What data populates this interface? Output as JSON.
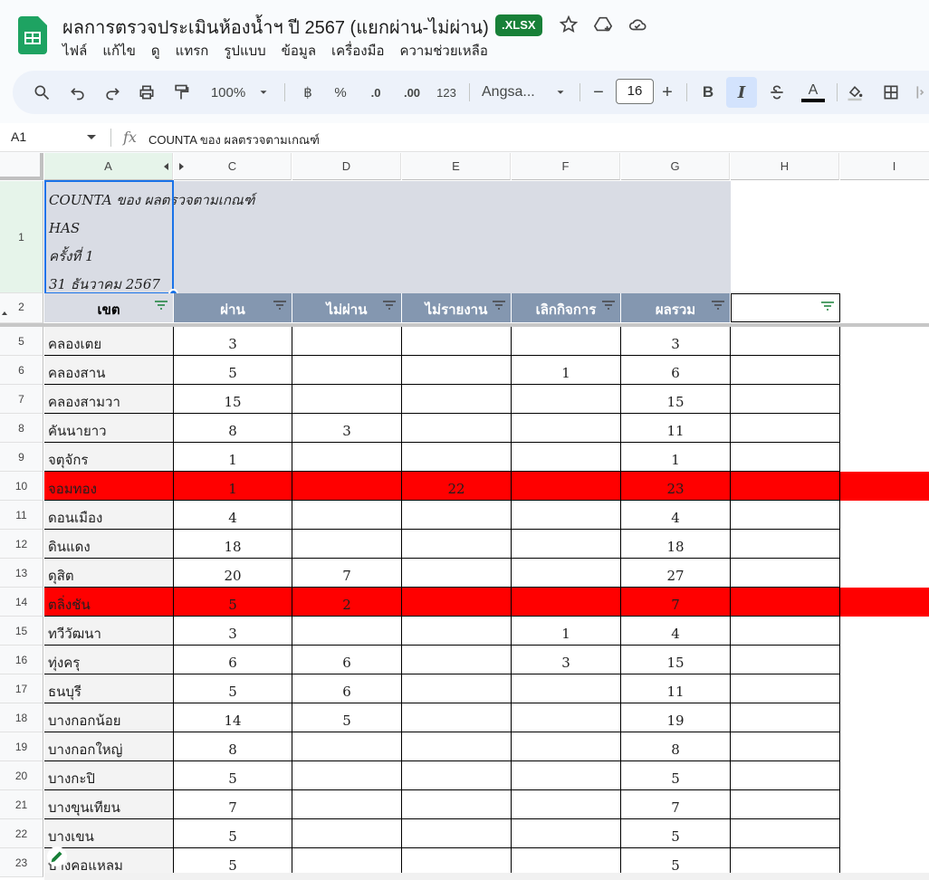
{
  "app": {
    "title": "ผลการตรวจประเมินห้องน้ำฯ ปี 2567 (แยกผ่าน-ไม่ผ่าน)",
    "badge": ".XLSX",
    "menu": [
      "ไฟล์",
      "แก้ไข",
      "ดู",
      "แทรก",
      "รูปแบบ",
      "ข้อมูล",
      "เครื่องมือ",
      "ความช่วยเหลือ"
    ]
  },
  "toolbar": {
    "zoom": "100%",
    "currency": "฿",
    "percent": "%",
    "dec_minus": ".0",
    "dec_plus": ".00",
    "format_123": "123",
    "font": "Angsa...",
    "font_size": "16",
    "bold": "B",
    "italic": "I",
    "minus": "−",
    "plus": "+",
    "text_color": "A"
  },
  "formula_bar": {
    "cell_ref": "A1",
    "fx": "fx",
    "formula": "COUNTA ของ ผลตรวจตามเกณฑ์"
  },
  "columns": [
    "A",
    "C",
    "D",
    "E",
    "F",
    "G",
    "H",
    "I"
  ],
  "pivot_title": {
    "line1": "COUNTA ของ ผลตรวจตามเกณฑ์",
    "line2": "HAS",
    "line3": "ครั้งที่ 1",
    "line4": "31 ธันวาคม 2567"
  },
  "headers": [
    "เขต",
    "ผ่าน",
    "ไม่ผ่าน",
    "ไม่รายงาน",
    "เลิกกิจการ",
    "ผลรวม"
  ],
  "rows": [
    {
      "num": "5",
      "name": "คลองเตย",
      "pass": "3",
      "fail": "",
      "noreport": "",
      "closed": "",
      "total": "3",
      "red": false
    },
    {
      "num": "6",
      "name": "คลองสาน",
      "pass": "5",
      "fail": "",
      "noreport": "",
      "closed": "1",
      "total": "6",
      "red": false
    },
    {
      "num": "7",
      "name": "คลองสามวา",
      "pass": "15",
      "fail": "",
      "noreport": "",
      "closed": "",
      "total": "15",
      "red": false
    },
    {
      "num": "8",
      "name": "คันนายาว",
      "pass": "8",
      "fail": "3",
      "noreport": "",
      "closed": "",
      "total": "11",
      "red": false
    },
    {
      "num": "9",
      "name": "จตุจักร",
      "pass": "1",
      "fail": "",
      "noreport": "",
      "closed": "",
      "total": "1",
      "red": false
    },
    {
      "num": "10",
      "name": "จอมทอง",
      "pass": "1",
      "fail": "",
      "noreport": "22",
      "closed": "",
      "total": "23",
      "red": true
    },
    {
      "num": "11",
      "name": "ดอนเมือง",
      "pass": "4",
      "fail": "",
      "noreport": "",
      "closed": "",
      "total": "4",
      "red": false
    },
    {
      "num": "12",
      "name": "ดินแดง",
      "pass": "18",
      "fail": "",
      "noreport": "",
      "closed": "",
      "total": "18",
      "red": false
    },
    {
      "num": "13",
      "name": "ดุสิต",
      "pass": "20",
      "fail": "7",
      "noreport": "",
      "closed": "",
      "total": "27",
      "red": false
    },
    {
      "num": "14",
      "name": "ตลิ่งชัน",
      "pass": "5",
      "fail": "2",
      "noreport": "",
      "closed": "",
      "total": "7",
      "red": true
    },
    {
      "num": "15",
      "name": "ทวีวัฒนา",
      "pass": "3",
      "fail": "",
      "noreport": "",
      "closed": "1",
      "total": "4",
      "red": false
    },
    {
      "num": "16",
      "name": "ทุ่งครุ",
      "pass": "6",
      "fail": "6",
      "noreport": "",
      "closed": "3",
      "total": "15",
      "red": false
    },
    {
      "num": "17",
      "name": "ธนบุรี",
      "pass": "5",
      "fail": "6",
      "noreport": "",
      "closed": "",
      "total": "11",
      "red": false
    },
    {
      "num": "18",
      "name": "บางกอกน้อย",
      "pass": "14",
      "fail": "5",
      "noreport": "",
      "closed": "",
      "total": "19",
      "red": false
    },
    {
      "num": "19",
      "name": "บางกอกใหญ่",
      "pass": "8",
      "fail": "",
      "noreport": "",
      "closed": "",
      "total": "8",
      "red": false
    },
    {
      "num": "20",
      "name": "บางกะปิ",
      "pass": "5",
      "fail": "",
      "noreport": "",
      "closed": "",
      "total": "5",
      "red": false
    },
    {
      "num": "21",
      "name": "บางขุนเทียน",
      "pass": "7",
      "fail": "",
      "noreport": "",
      "closed": "",
      "total": "7",
      "red": false
    },
    {
      "num": "22",
      "name": "บางเขน",
      "pass": "5",
      "fail": "",
      "noreport": "",
      "closed": "",
      "total": "5",
      "red": false
    },
    {
      "num": "23",
      "name": "บางคอแหลม",
      "pass": "5",
      "fail": "",
      "noreport": "",
      "closed": "",
      "total": "5",
      "red": false
    }
  ],
  "row_numbers_top": [
    "1",
    "2"
  ],
  "colors": {
    "header_bg": "#8497b0",
    "red_row": "#ff0000",
    "title_bg": "#d9dce4",
    "badge_bg": "#188038"
  }
}
